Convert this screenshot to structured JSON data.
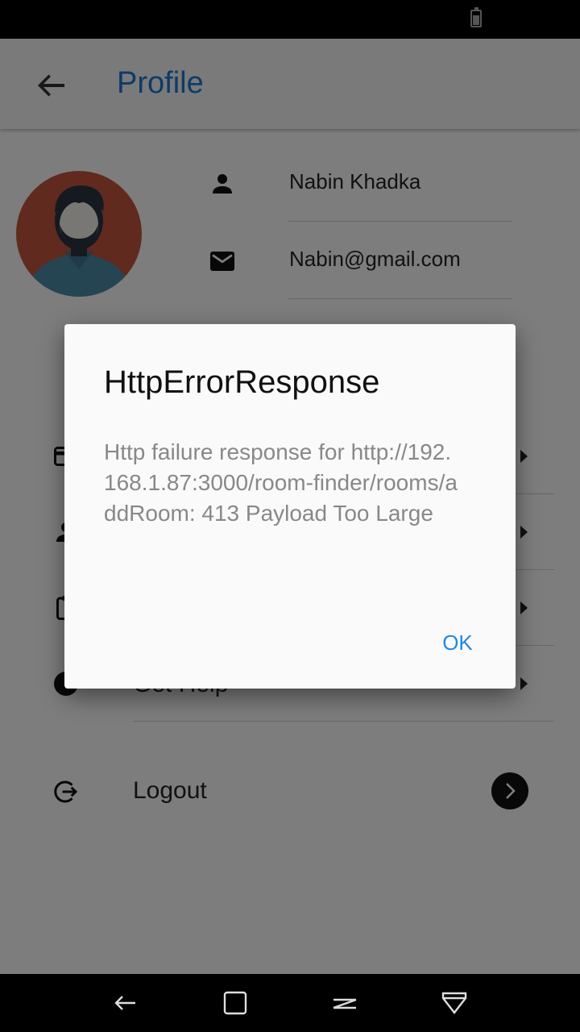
{
  "app_bar": {
    "title": "Profile",
    "back_icon": "arrow-back-icon"
  },
  "profile": {
    "name": "Nabin Khadka",
    "email": "Nabin@gmail.com",
    "name_icon": "person-icon",
    "email_icon": "mail-icon"
  },
  "menu": {
    "items": [
      {
        "label": "",
        "icon": "card-icon"
      },
      {
        "label": "",
        "icon": "person-icon"
      },
      {
        "label": "",
        "icon": "clipboard-icon"
      },
      {
        "label": "Get Help",
        "icon": "help-icon"
      }
    ],
    "logout": {
      "label": "Logout",
      "icon": "logout-icon"
    }
  },
  "dialog": {
    "title": "HttpErrorResponse",
    "message": "Http failure response for http://192.168.1.87:3000/room-finder/rooms/addRoom: 413 Payload Too Large",
    "ok_label": "OK"
  },
  "colors": {
    "accent": "#1976d2",
    "dialog_button": "#1e88e5",
    "avatar_bg": "#c0543d"
  }
}
